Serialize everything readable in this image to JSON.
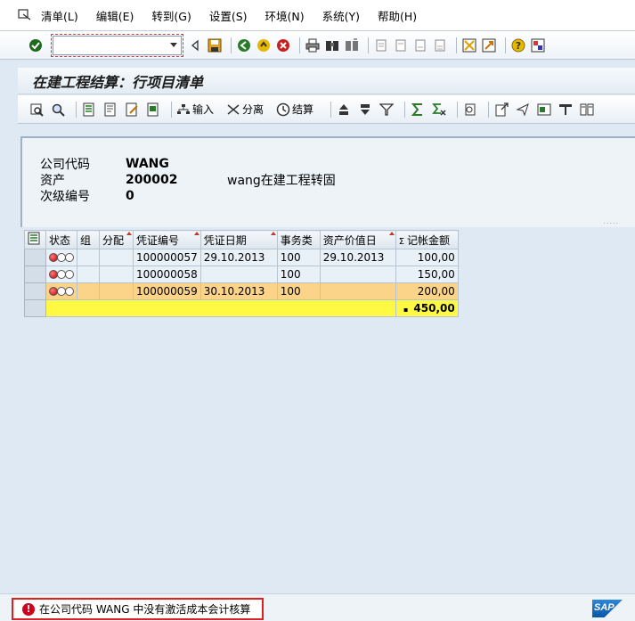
{
  "menu": {
    "items": [
      {
        "label": "清单(L)",
        "name": "menu-list"
      },
      {
        "label": "编辑(E)",
        "name": "menu-edit"
      },
      {
        "label": "转到(G)",
        "name": "menu-goto"
      },
      {
        "label": "设置(S)",
        "name": "menu-settings"
      },
      {
        "label": "环境(N)",
        "name": "menu-environment"
      },
      {
        "label": "系统(Y)",
        "name": "menu-system"
      },
      {
        "label": "帮助(H)",
        "name": "menu-help"
      }
    ]
  },
  "command_field": {
    "value": ""
  },
  "title": "在建工程结算：行项目清单",
  "app_toolbar": {
    "input_label": "输入",
    "split_label": "分离",
    "settle_label": "结算"
  },
  "header": {
    "company_code_label": "公司代码",
    "company_code_value": "WANG",
    "asset_label": "资产",
    "asset_value": "200002",
    "asset_description": "wang在建工程转固",
    "sub_number_label": "次级编号",
    "sub_number_value": "0"
  },
  "grid": {
    "columns": [
      {
        "key": "status",
        "label": "状态",
        "sorted": false
      },
      {
        "key": "group",
        "label": "组",
        "sorted": false
      },
      {
        "key": "alloc",
        "label": "分配",
        "sorted": true
      },
      {
        "key": "docno",
        "label": "凭证编号",
        "sorted": true
      },
      {
        "key": "docdate",
        "label": "凭证日期",
        "sorted": true
      },
      {
        "key": "trans",
        "label": "事务类",
        "sorted": false
      },
      {
        "key": "valdate",
        "label": "资产价值日",
        "sorted": true
      },
      {
        "key": "amount",
        "label": "记帐金额",
        "sum_symbol": "Σ"
      }
    ],
    "rows": [
      {
        "group": "",
        "alloc": "",
        "docno": "100000057",
        "docdate": "29.10.2013",
        "trans": "100",
        "valdate": "29.10.2013",
        "amount": "100,00",
        "selected": false
      },
      {
        "group": "",
        "alloc": "",
        "docno": "100000058",
        "docdate": "",
        "trans": "100",
        "valdate": "",
        "amount": "150,00",
        "selected": false
      },
      {
        "group": "",
        "alloc": "",
        "docno": "100000059",
        "docdate": "30.10.2013",
        "trans": "100",
        "valdate": "",
        "amount": "200,00",
        "selected": true
      }
    ],
    "total": {
      "marker": "▪",
      "amount": "450,00"
    }
  },
  "status_bar": {
    "message": "在公司代码 WANG 中没有激活成本会计核算",
    "logo": "SAP"
  },
  "colors": {
    "selected_row": "#fbd48a",
    "total_row": "#fff944",
    "error": "#d0021b"
  }
}
